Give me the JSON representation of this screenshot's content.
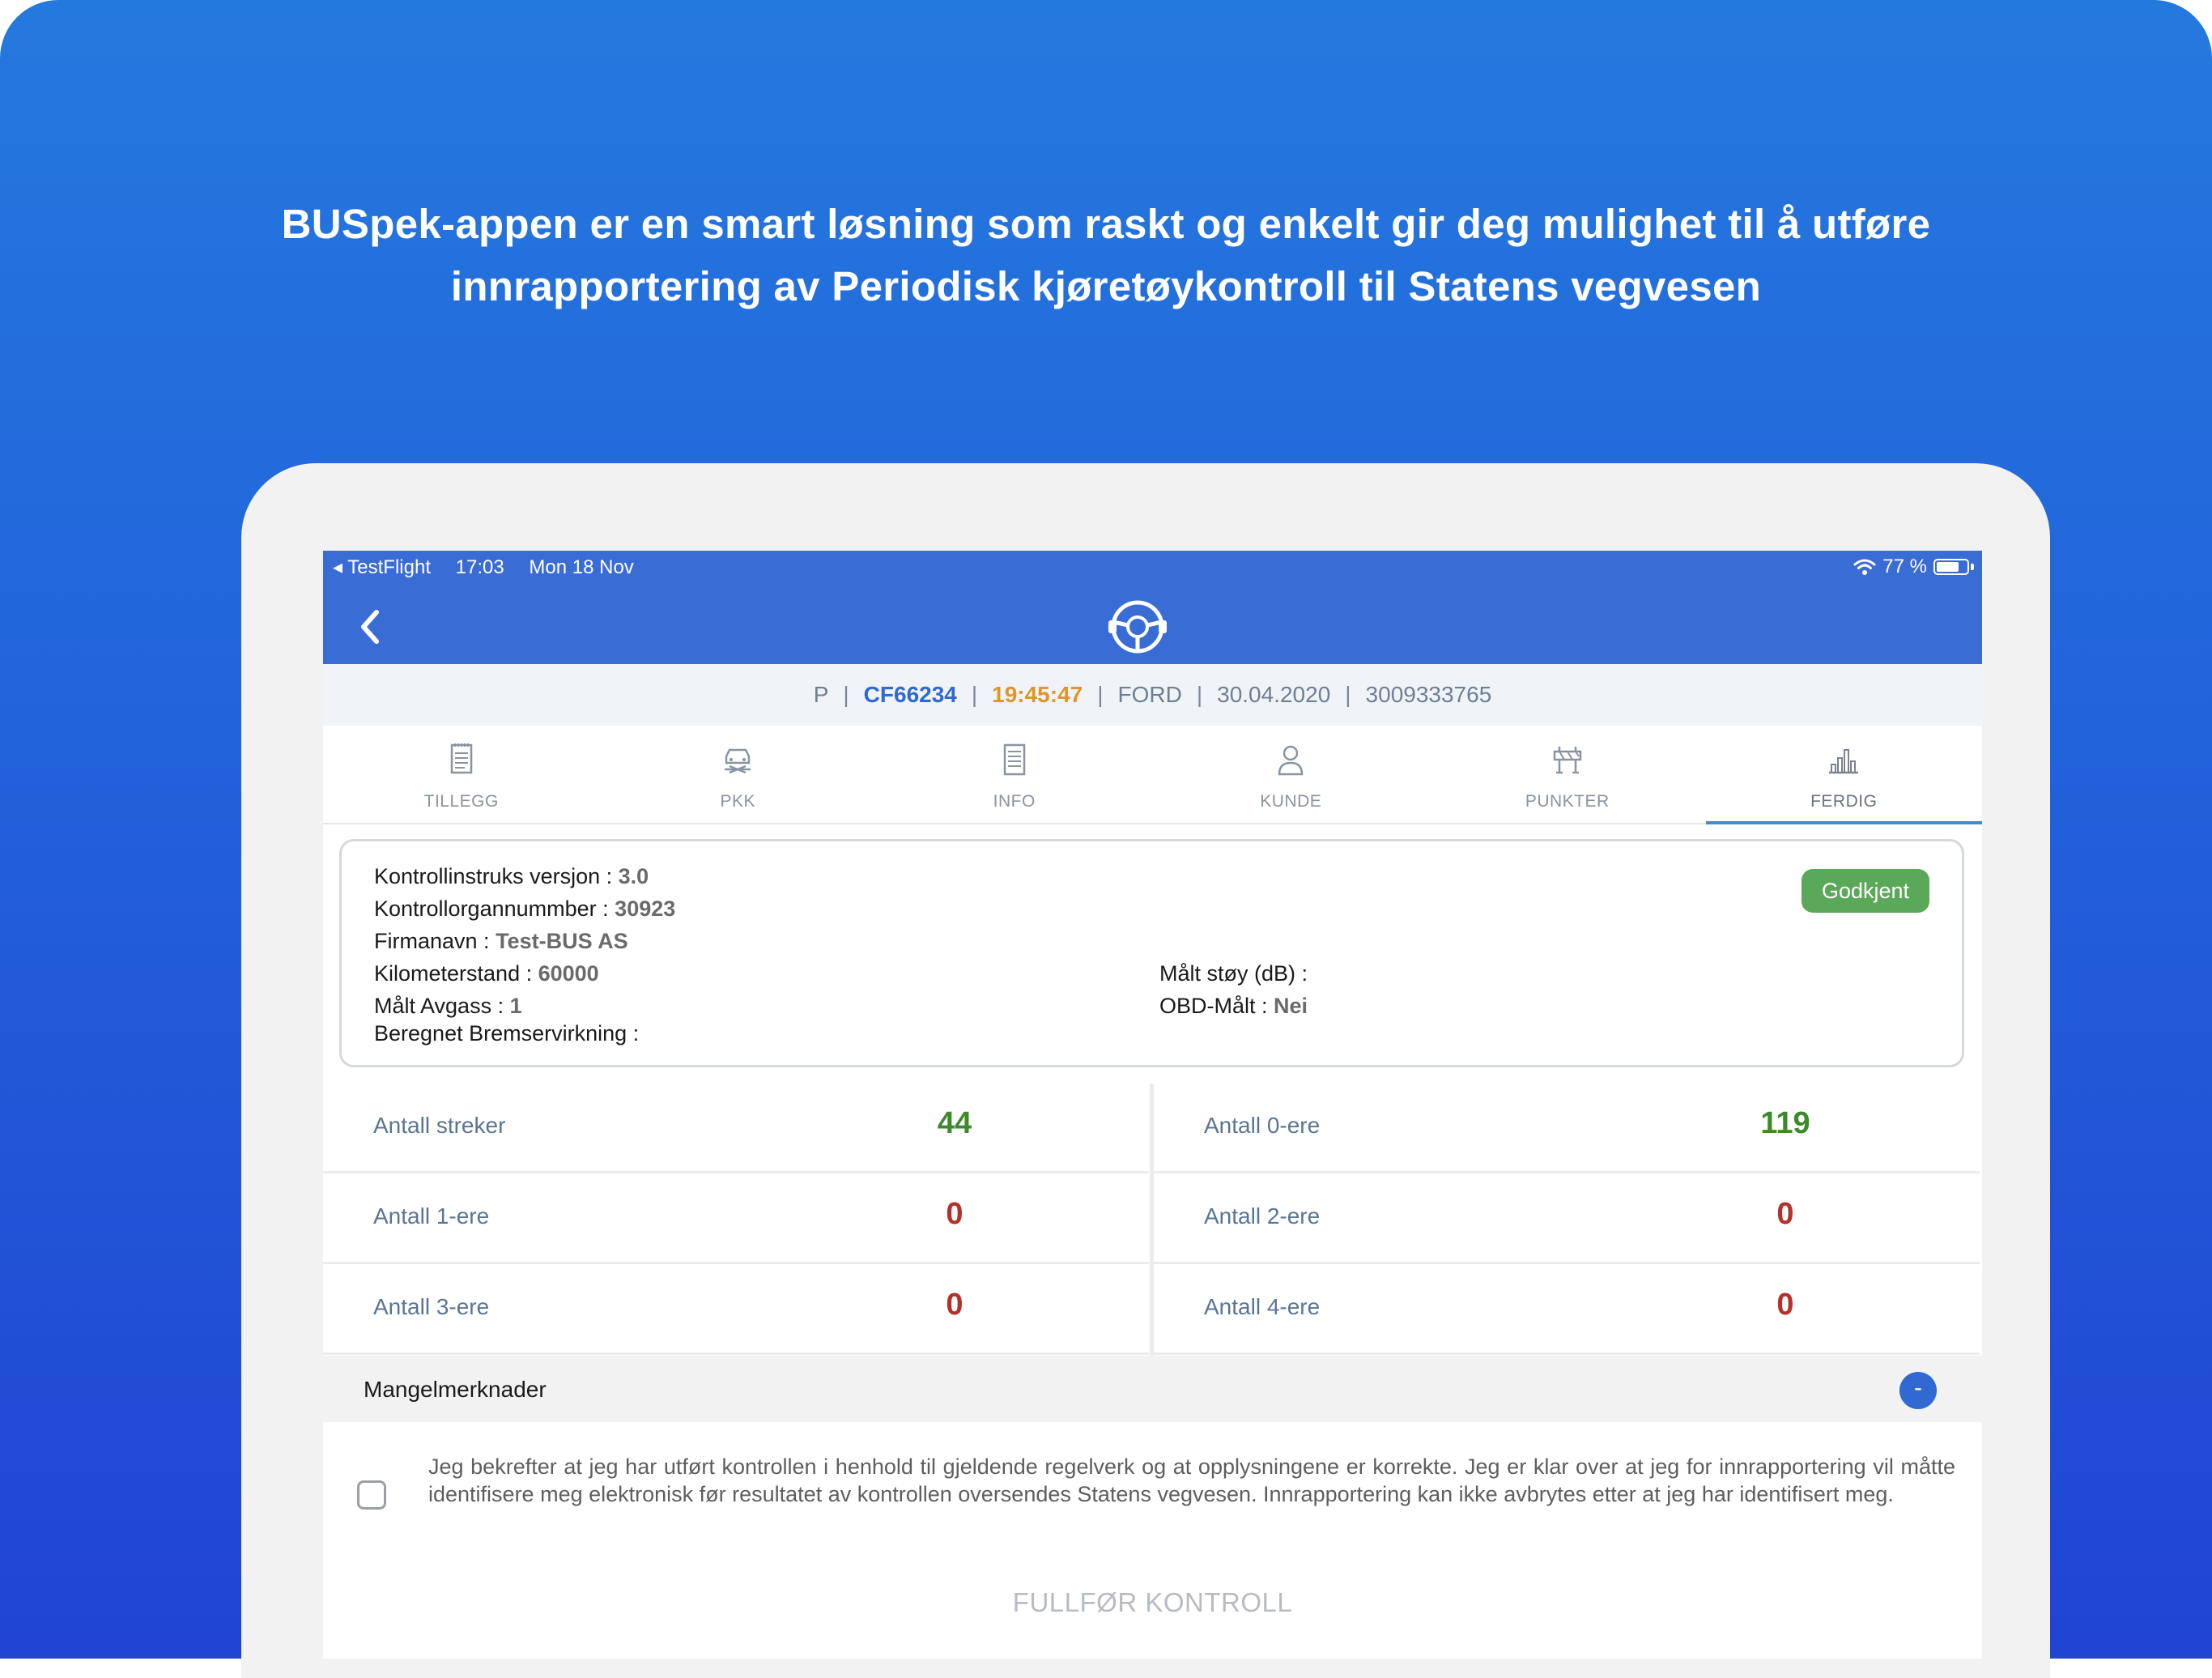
{
  "headline": {
    "line1": "BUSpek-appen er en smart løsning som raskt og enkelt gir deg mulighet til å utføre",
    "line2": "innrapportering av Periodisk kjøretøykontroll til Statens vegvesen"
  },
  "status_bar": {
    "app": "◂ TestFlight",
    "time": "17:03",
    "date": "Mon 18 Nov",
    "battery": "77 %"
  },
  "vehicle_info": {
    "type": "P",
    "plate": "CF66234",
    "timer": "19:45:47",
    "make": "FORD",
    "date": "30.04.2020",
    "number": "3009333765",
    "separator": "|"
  },
  "tabs": [
    {
      "label": "TILLEGG",
      "icon": "document-icon"
    },
    {
      "label": "PKK",
      "icon": "car-wrench-icon"
    },
    {
      "label": "INFO",
      "icon": "info-document-icon"
    },
    {
      "label": "KUNDE",
      "icon": "person-icon"
    },
    {
      "label": "PUNKTER",
      "icon": "barrier-icon"
    },
    {
      "label": "FERDIG",
      "icon": "bar-chart-icon"
    }
  ],
  "summary": {
    "instruks_label": "Kontrollinstruks versjon :",
    "instruks_value": "3.0",
    "organ_label": "Kontrollorgannummber :",
    "organ_value": "30923",
    "firma_label": "Firmanavn :",
    "firma_value": "Test-BUS AS",
    "km_label": "Kilometerstand :",
    "km_value": "60000",
    "avgass_label": "Målt Avgass :",
    "avgass_value": "1",
    "brems_label": "Beregnet Bremservirkning :",
    "stoy_label": "Målt støy (dB) :",
    "obd_label": "OBD-Målt :",
    "obd_value": "Nei",
    "status_badge": "Godkjent"
  },
  "counts": [
    {
      "label": "Antall streker",
      "value": "44",
      "color": "#3d8a2a"
    },
    {
      "label": "Antall 0-ere",
      "value": "119",
      "color": "#3d8a2a"
    },
    {
      "label": "Antall 1-ere",
      "value": "0",
      "color": "#b5302a"
    },
    {
      "label": "Antall 2-ere",
      "value": "0",
      "color": "#b5302a"
    },
    {
      "label": "Antall 3-ere",
      "value": "0",
      "color": "#b5302a"
    },
    {
      "label": "Antall 4-ere",
      "value": "0",
      "color": "#b5302a"
    }
  ],
  "mangel": {
    "title": "Mangelmerknader",
    "toggle": "-"
  },
  "confirmation": {
    "text": "Jeg bekrefter at jeg har utført kontrollen i henhold til gjeldende regelverk og at opplysningene er korrekte. Jeg er klar over at jeg for innrapportering vil måtte identifisere meg elektronisk før resultatet av kontrollen oversendes Statens vegvesen. Innrapportering kan ikke avbrytes etter at jeg har identifisert meg."
  },
  "finish_button": "FULLFØR KONTROLL",
  "colors": {
    "brand_blue": "#3a6cd6",
    "plate_blue": "#2f69d1",
    "timer_orange": "#e0962a",
    "approved_green": "#5aa85a"
  }
}
